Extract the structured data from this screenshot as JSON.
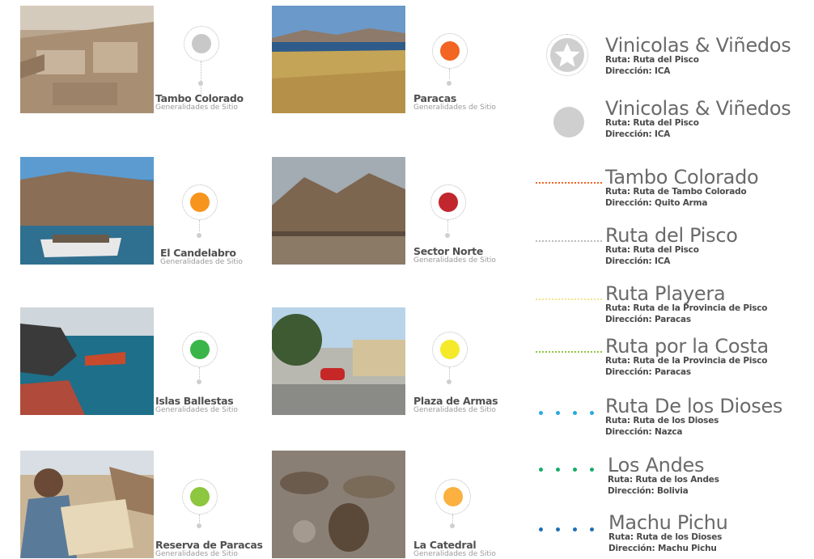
{
  "colors": {
    "tambo_colorado": "#c8c8c8",
    "paracas": "#f26522",
    "el_candelabro": "#f7941d",
    "sector_norte": "#c1272d",
    "islas_ballestas": "#39b54a",
    "plaza_de_armas": "#f4ea2a",
    "reserva_de_paracas": "#8dc63f",
    "la_catedral": "#fbb040"
  },
  "sites": [
    {
      "name": "Tambo Colorado",
      "subtitle": "Generalidades de Sitio"
    },
    {
      "name": "Paracas",
      "subtitle": "Generalidades de Sitio"
    },
    {
      "name": "El Candelabro",
      "subtitle": "Generalidades de Sitio"
    },
    {
      "name": "Sector Norte",
      "subtitle": "Generalidades de Sitio"
    },
    {
      "name": "Islas Ballestas",
      "subtitle": "Generalidades de Sitio"
    },
    {
      "name": "Plaza de Armas",
      "subtitle": "Generalidades de Sitio"
    },
    {
      "name": "Reserva de Paracas",
      "subtitle": "Generalidades de Sitio"
    },
    {
      "name": "La Catedral",
      "subtitle": "Generalidades de Sitio"
    }
  ],
  "legend": [
    {
      "symbol": "star-icon",
      "color": "#c8c8c8",
      "title": "Vinicolas & Viñedos",
      "ruta": "Ruta: Ruta del Pisco",
      "direccion": "Dirección: ICA"
    },
    {
      "symbol": "circle-icon",
      "color": "#cfcfcf",
      "title": "Vinicolas & Viñedos",
      "ruta": "Ruta: Ruta del Pisco",
      "direccion": "Dirección: ICA"
    },
    {
      "symbol": "dotted-line",
      "color": "#f26522",
      "title": "Tambo Colorado",
      "ruta": "Ruta: Ruta de Tambo Colorado",
      "direccion": "Dirección: Quito Arma"
    },
    {
      "symbol": "dotted-line",
      "color": "#bdbdbd",
      "title": "Ruta del Pisco",
      "ruta": "Ruta: Ruta del Pisco",
      "direccion": "Dirección: ICA"
    },
    {
      "symbol": "dotted-line",
      "color": "#f6e58d",
      "title": "Ruta Playera",
      "ruta": "Ruta: Ruta de la Provincia de Pisco",
      "direccion": "Dirección: Paracas"
    },
    {
      "symbol": "dotted-line",
      "color": "#8dc63f",
      "title": "Ruta por la Costa",
      "ruta": "Ruta: Ruta de la Provincia de Pisco",
      "direccion": "Dirección: Paracas"
    },
    {
      "symbol": "big-dots",
      "color": "#29a8e0",
      "title": "Ruta De los Dioses",
      "ruta": "Ruta: Ruta de los Dioses",
      "direccion": "Dirección: Nazca"
    },
    {
      "symbol": "big-dots",
      "color": "#1aab6a",
      "title": "Los Andes",
      "ruta": "Ruta: Ruta de los Andes",
      "direccion": "Dirección: Bolivia"
    },
    {
      "symbol": "big-dots",
      "color": "#1f6fb5",
      "title": "Machu Pichu",
      "ruta": "Ruta: Ruta de los Dioses",
      "direccion": "Dirección: Machu Pichu"
    }
  ]
}
